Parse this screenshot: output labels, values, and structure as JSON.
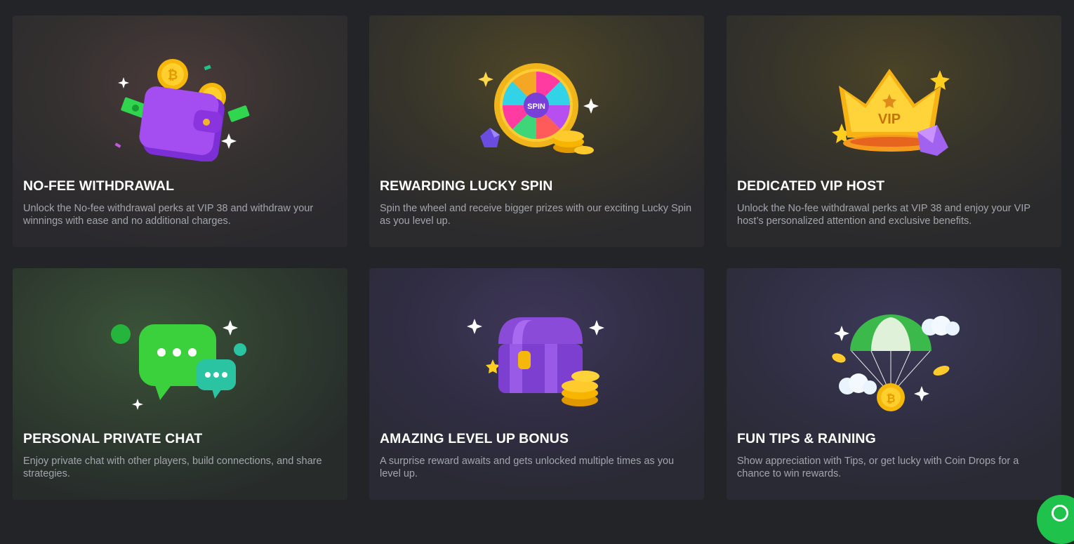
{
  "features": [
    {
      "title": "NO-FEE WITHDRAWAL",
      "description": "Unlock the No-fee withdrawal perks at VIP 38 and withdraw your winnings with ease and no additional charges.",
      "icon": "wallet-icon"
    },
    {
      "title": "REWARDING LUCKY SPIN",
      "description": "Spin the wheel and receive bigger prizes with our exciting Lucky Spin as you level up.",
      "icon": "lucky-wheel-icon",
      "icon_text": "SPIN"
    },
    {
      "title": "DEDICATED VIP HOST",
      "description": "Unlock the No-fee withdrawal perks at VIP 38 and enjoy your VIP host’s personalized attention and exclusive benefits.",
      "icon": "vip-crown-icon",
      "icon_text": "VIP"
    },
    {
      "title": "PERSONAL PRIVATE CHAT",
      "description": "Enjoy private chat with other players, build connections, and share strategies.",
      "icon": "chat-bubbles-icon"
    },
    {
      "title": "AMAZING LEVEL UP BONUS",
      "description": "A surprise reward awaits and gets unlocked multiple times as you level up.",
      "icon": "treasure-chest-icon"
    },
    {
      "title": "FUN TIPS & RAINING",
      "description": "Show appreciation with Tips, or get lucky with Coin Drops for a chance to win rewards.",
      "icon": "parachute-coin-icon"
    }
  ],
  "colors": {
    "page_background": "#232428",
    "title": "#ffffff",
    "description": "#a3a5ad",
    "chat_button": "#1fc24a"
  },
  "floating_button": {
    "icon": "live-chat-icon"
  }
}
